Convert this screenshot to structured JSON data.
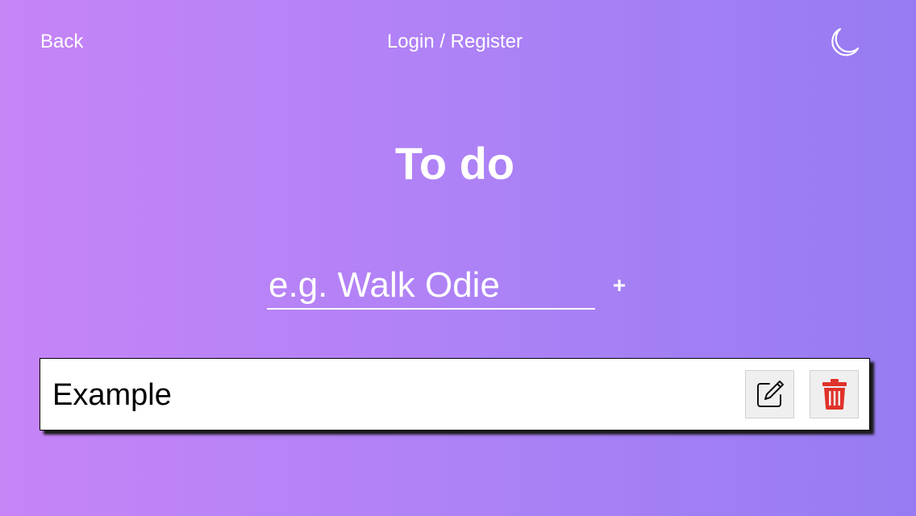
{
  "header": {
    "back_label": "Back",
    "login_label": "Login / Register",
    "theme_icon": "moon-icon"
  },
  "main": {
    "title": "To do",
    "input": {
      "placeholder": "e.g. Walk Odie",
      "value": ""
    },
    "add_label": "+"
  },
  "todos": [
    {
      "text": "Example",
      "edit_icon": "pencil-square-icon",
      "delete_icon": "trash-icon"
    }
  ],
  "colors": {
    "gradient_start": "#c684f7",
    "gradient_end": "#967bf2",
    "delete_icon": "#e0322a",
    "text_light": "#ffffff"
  }
}
